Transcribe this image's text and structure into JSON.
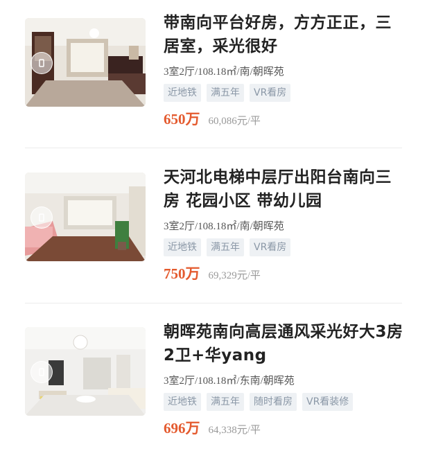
{
  "listings": [
    {
      "title": "带南向平台好房，方方正正，三居室，采光很好",
      "meta": "3室2厅/108.18㎡/南/朝晖苑",
      "tags": [
        "近地铁",
        "满五年",
        "VR看房"
      ],
      "total_price": "650万",
      "unit_price": "60,086元/平"
    },
    {
      "title": "天河北电梯中层厅出阳台南向三房 花园小区 带幼儿园",
      "meta": "3室2厅/108.18㎡/南/朝晖苑",
      "tags": [
        "近地铁",
        "满五年",
        "VR看房"
      ],
      "total_price": "750万",
      "unit_price": "69,329元/平"
    },
    {
      "title": "朝晖苑南向高层通风采光好大3房2卫+华yang",
      "meta": "3室2厅/108.18㎡/东南/朝晖苑",
      "tags": [
        "近地铁",
        "满五年",
        "随时看房",
        "VR看装修"
      ],
      "total_price": "696万",
      "unit_price": "64,338元/平"
    }
  ],
  "colors": {
    "price": "#e45a2e",
    "tag_bg": "#eef1f4",
    "tag_text": "#8a97a6"
  },
  "icons": {
    "vr_badge": "vr-badge-icon"
  }
}
